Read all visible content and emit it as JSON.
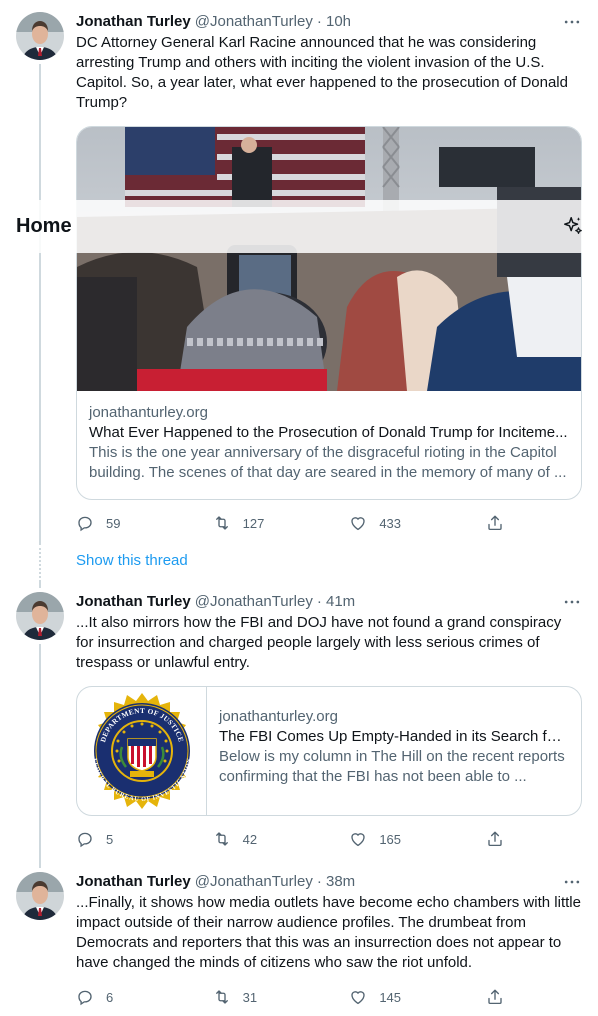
{
  "header": {
    "title": "Home",
    "sparkle_icon": "sparkle-icon"
  },
  "tweets": [
    {
      "name": "Jonathan Turley",
      "handle": "@JonathanTurley",
      "time": "· 10h",
      "text": "DC Attorney General Karl Racine announced that he was considering arresting Trump and others with inciting the violent invasion of the U.S. Capitol.  So, a year later, what ever happened to the prosecution of Donald Trump?",
      "card": {
        "domain": "jonathanturley.org",
        "title": "What Ever Happened to the Prosecution of Donald Trump for Inciteme...",
        "description": "This is the one year anniversary of the disgraceful rioting in the Capitol building. The scenes of that day are seared in the memory of many of ..."
      },
      "replies": "59",
      "retweets": "127",
      "likes": "433"
    },
    {
      "name": "Jonathan Turley",
      "handle": "@JonathanTurley",
      "time": "· 41m",
      "text": "...It also mirrors how the FBI and DOJ have not found a grand conspiracy for insurrection and charged people largely with less serious crimes of trespass or unlawful entry.",
      "card": {
        "domain": "jonathanturley.org",
        "title": "The FBI Comes Up Empty-Handed in its Search for...",
        "description": "Below is my column in The Hill on the recent reports confirming that the FBI has not been able to ..."
      },
      "replies": "5",
      "retweets": "42",
      "likes": "165"
    },
    {
      "name": "Jonathan Turley",
      "handle": "@JonathanTurley",
      "time": "· 38m",
      "text": "...Finally, it shows how media outlets have become echo chambers with little impact outside of their narrow audience profiles. The drumbeat from Democrats and reporters that this was an insurrection does not appear to have changed the minds of citizens who saw the riot unfold.",
      "replies": "6",
      "retweets": "31",
      "likes": "145"
    }
  ],
  "show_thread": "Show this thread",
  "seal": {
    "top_text": "DEPARTMENT OF JUSTICE",
    "bottom_text": "FEDERAL BUREAU OF INVESTIGATION"
  },
  "colors": {
    "accent": "#1d9bf0",
    "muted": "#536471",
    "border": "#cfd9de"
  }
}
